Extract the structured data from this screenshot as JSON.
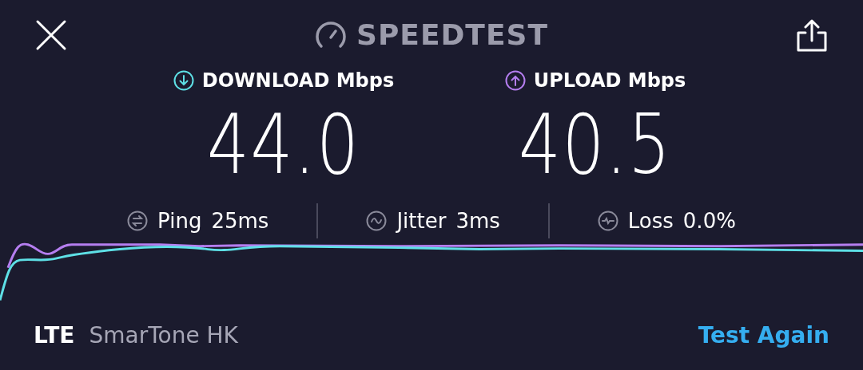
{
  "header": {
    "title": "SPEEDTEST"
  },
  "results": [
    {
      "kind": "download",
      "label": "DOWNLOAD Mbps",
      "value": "44.0",
      "color": "#5ee0e6"
    },
    {
      "kind": "upload",
      "label": "UPLOAD Mbps",
      "value": "40.5",
      "color": "#b57ef0"
    }
  ],
  "metrics": [
    {
      "kind": "ping",
      "label": "Ping",
      "value": "25ms"
    },
    {
      "kind": "jitter",
      "label": "Jitter",
      "value": "3ms"
    },
    {
      "kind": "loss",
      "label": "Loss",
      "value": "0.0%"
    }
  ],
  "footer": {
    "network_type": "LTE",
    "carrier": "SmarTone HK",
    "action": "Test Again"
  }
}
